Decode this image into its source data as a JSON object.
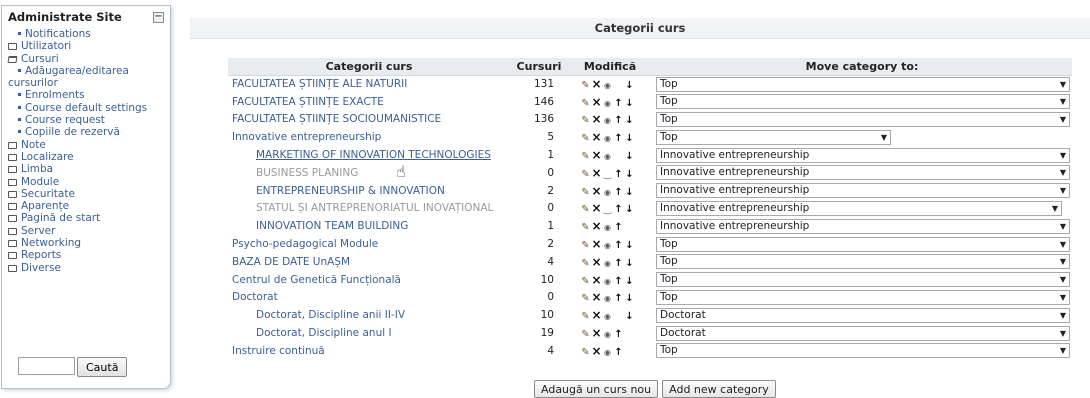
{
  "sidebar": {
    "title": "Administrate Site",
    "collapse_symbol": "−",
    "items": [
      {
        "label": "Notifications",
        "kind": "leaf",
        "indent": "l2"
      },
      {
        "label": "Utilizatori",
        "kind": "folder",
        "indent": "l1"
      },
      {
        "label": "Cursuri",
        "kind": "folder-open",
        "indent": "l1"
      },
      {
        "label": "Adăugarea/editarea",
        "kind": "leaf",
        "indent": "l2"
      },
      {
        "label": "cursurilor",
        "kind": "wrap",
        "indent": "l2w"
      },
      {
        "label": "Enrolments",
        "kind": "leaf",
        "indent": "l2"
      },
      {
        "label": "Course default settings",
        "kind": "leaf",
        "indent": "l2"
      },
      {
        "label": "Course request",
        "kind": "leaf",
        "indent": "l2"
      },
      {
        "label": "Copiile de rezervă",
        "kind": "leaf",
        "indent": "l2"
      },
      {
        "label": "Note",
        "kind": "folder",
        "indent": "l1"
      },
      {
        "label": "Localizare",
        "kind": "folder",
        "indent": "l1"
      },
      {
        "label": "Limba",
        "kind": "folder",
        "indent": "l1"
      },
      {
        "label": "Module",
        "kind": "folder",
        "indent": "l1"
      },
      {
        "label": "Securitate",
        "kind": "folder",
        "indent": "l1"
      },
      {
        "label": "Aparențe",
        "kind": "folder",
        "indent": "l1"
      },
      {
        "label": "Pagină de start",
        "kind": "folder",
        "indent": "l1"
      },
      {
        "label": "Server",
        "kind": "folder",
        "indent": "l1"
      },
      {
        "label": "Networking",
        "kind": "folder",
        "indent": "l1"
      },
      {
        "label": "Reports",
        "kind": "folder",
        "indent": "l1"
      },
      {
        "label": "Diverse",
        "kind": "folder",
        "indent": "l1"
      }
    ],
    "search": {
      "value": "",
      "button_label": "Caută"
    }
  },
  "main": {
    "title": "Categorii curs",
    "columns": [
      "Categorii curs",
      "Cursuri",
      "Modifică",
      "Move category to:"
    ],
    "rows": [
      {
        "name": "FACULTATEA ȘTIINȚE ALE NATURII",
        "count": "131",
        "level": 0,
        "style": "normal",
        "eye": "open",
        "up": false,
        "down": true,
        "move_to": "Top",
        "select_width": "full"
      },
      {
        "name": "FACULTATEA ȘTIINȚE EXACTE",
        "count": "146",
        "level": 0,
        "style": "normal",
        "eye": "open",
        "up": true,
        "down": true,
        "move_to": "Top",
        "select_width": "full"
      },
      {
        "name": "FACULTATEA ȘTIINȚE SOCIOUMANISTICE",
        "count": "136",
        "level": 0,
        "style": "normal",
        "eye": "open",
        "up": true,
        "down": true,
        "move_to": "Top",
        "select_width": "full"
      },
      {
        "name": "Innovative entrepreneurship",
        "count": "5",
        "level": 0,
        "style": "normal",
        "eye": "open",
        "up": true,
        "down": true,
        "move_to": "Top",
        "select_width": "short"
      },
      {
        "name": "MARKETING OF INNOVATION TECHNOLOGIES",
        "count": "1",
        "level": 1,
        "style": "link",
        "eye": "open",
        "up": false,
        "down": true,
        "move_to": "Innovative entrepreneurship",
        "select_width": "full"
      },
      {
        "name": "BUSINESS PLANING",
        "count": "0",
        "level": 1,
        "style": "dim",
        "eye": "closed",
        "up": true,
        "down": true,
        "move_to": "Innovative entrepreneurship",
        "select_width": "full"
      },
      {
        "name": "ENTREPRENEURSHIP & INNOVATION",
        "count": "2",
        "level": 1,
        "style": "normal",
        "eye": "open",
        "up": true,
        "down": true,
        "move_to": "Innovative entrepreneurship",
        "select_width": "full"
      },
      {
        "name": "STATUL ȘI ANTREPRENORIATUL INOVAȚIONAL",
        "count": "0",
        "level": 1,
        "style": "dim",
        "eye": "closed",
        "up": true,
        "down": true,
        "move_to": "Innovative entrepreneurship",
        "select_width": "wide"
      },
      {
        "name": "INNOVATION TEAM BUILDING",
        "count": "1",
        "level": 1,
        "style": "normal",
        "eye": "open",
        "up": true,
        "down": false,
        "move_to": "Innovative entrepreneurship",
        "select_width": "full"
      },
      {
        "name": "Psycho-pedagogical Module",
        "count": "2",
        "level": 0,
        "style": "normal",
        "eye": "open",
        "up": true,
        "down": true,
        "move_to": "Top",
        "select_width": "full"
      },
      {
        "name": "BAZA DE DATE UnAȘM",
        "count": "4",
        "level": 0,
        "style": "normal",
        "eye": "open",
        "up": true,
        "down": true,
        "move_to": "Top",
        "select_width": "full"
      },
      {
        "name": "Centrul de Genetică Funcțională",
        "count": "10",
        "level": 0,
        "style": "normal",
        "eye": "open",
        "up": true,
        "down": true,
        "move_to": "Top",
        "select_width": "full"
      },
      {
        "name": "Doctorat",
        "count": "0",
        "level": 0,
        "style": "normal",
        "eye": "open",
        "up": true,
        "down": true,
        "move_to": "Top",
        "select_width": "full"
      },
      {
        "name": "Doctorat, Discipline anii II-IV",
        "count": "10",
        "level": 1,
        "style": "normal",
        "eye": "open",
        "up": false,
        "down": true,
        "move_to": "Doctorat",
        "select_width": "full"
      },
      {
        "name": "Doctorat, Discipline anul I",
        "count": "19",
        "level": 1,
        "style": "normal",
        "eye": "open",
        "up": true,
        "down": false,
        "move_to": "Doctorat",
        "select_width": "full"
      },
      {
        "name": "Instruire continuă",
        "count": "4",
        "level": 0,
        "style": "normal",
        "eye": "open",
        "up": true,
        "down": false,
        "move_to": "Top",
        "select_width": "full"
      }
    ],
    "buttons": {
      "add_course": "Adaugă un curs nou",
      "add_category": "Add new category"
    }
  },
  "icons": {
    "edit": "edit-pencil-icon",
    "delete": "delete-x-icon",
    "eye": "eye-open-icon",
    "eye_closed": "eye-closed-icon",
    "up": "arrow-up-icon",
    "down": "arrow-down-icon",
    "dropdown": "dropdown-arrow-icon"
  },
  "colors": {
    "link": "#3a5f95",
    "dim": "#9a9a9a",
    "header_bg": "#e8ebef"
  }
}
